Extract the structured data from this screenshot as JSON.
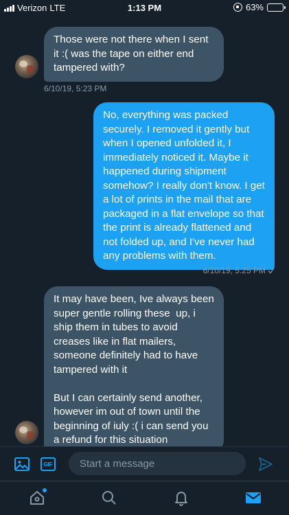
{
  "status_bar": {
    "carrier": "Verizon",
    "network": "LTE",
    "time": "1:13 PM",
    "battery": "63%",
    "battery_level": 0.63
  },
  "thread": {
    "messages": [
      {
        "direction": "incoming",
        "text": "Those were not there when I sent it :( was the tape on either end tampered with?",
        "timestamp": "6/10/19, 5:23 PM"
      },
      {
        "direction": "outgoing",
        "text": "No, everything was packed securely. I removed it gently but when I opened unfolded it, I immediately noticed it. Maybe it happened during shipment somehow? I really don't know. I get a lot of prints in the mail that are packaged in a flat envelope so that the print is already flattened and not folded up, and I've never had any problems with them.",
        "timestamp": "6/10/19, 5:25 PM",
        "status_icon": "check-icon"
      },
      {
        "direction": "incoming",
        "text": "It may have been, Ive always been super gentle rolling these  up, i ship them in tubes to avoid creases like in flat mailers, someone definitely had to have tampered with it\n\nBut I can certainly send another, however im out of town until the beginning of iuly :( i can send you a refund for this situation"
      }
    ]
  },
  "composer": {
    "placeholder": "Start a message",
    "gif_label": "GIF",
    "icons": [
      "image-icon",
      "gif-icon",
      "send-icon"
    ]
  },
  "tabbar": {
    "items": [
      "home-icon",
      "search-icon",
      "notifications-icon",
      "messages-icon"
    ],
    "active": "messages-icon"
  },
  "colors": {
    "background": "#15202b",
    "incoming_bubble": "#3d5466",
    "outgoing_bubble": "#1da1f2",
    "accent": "#1da1f2",
    "muted": "#8899a6"
  }
}
